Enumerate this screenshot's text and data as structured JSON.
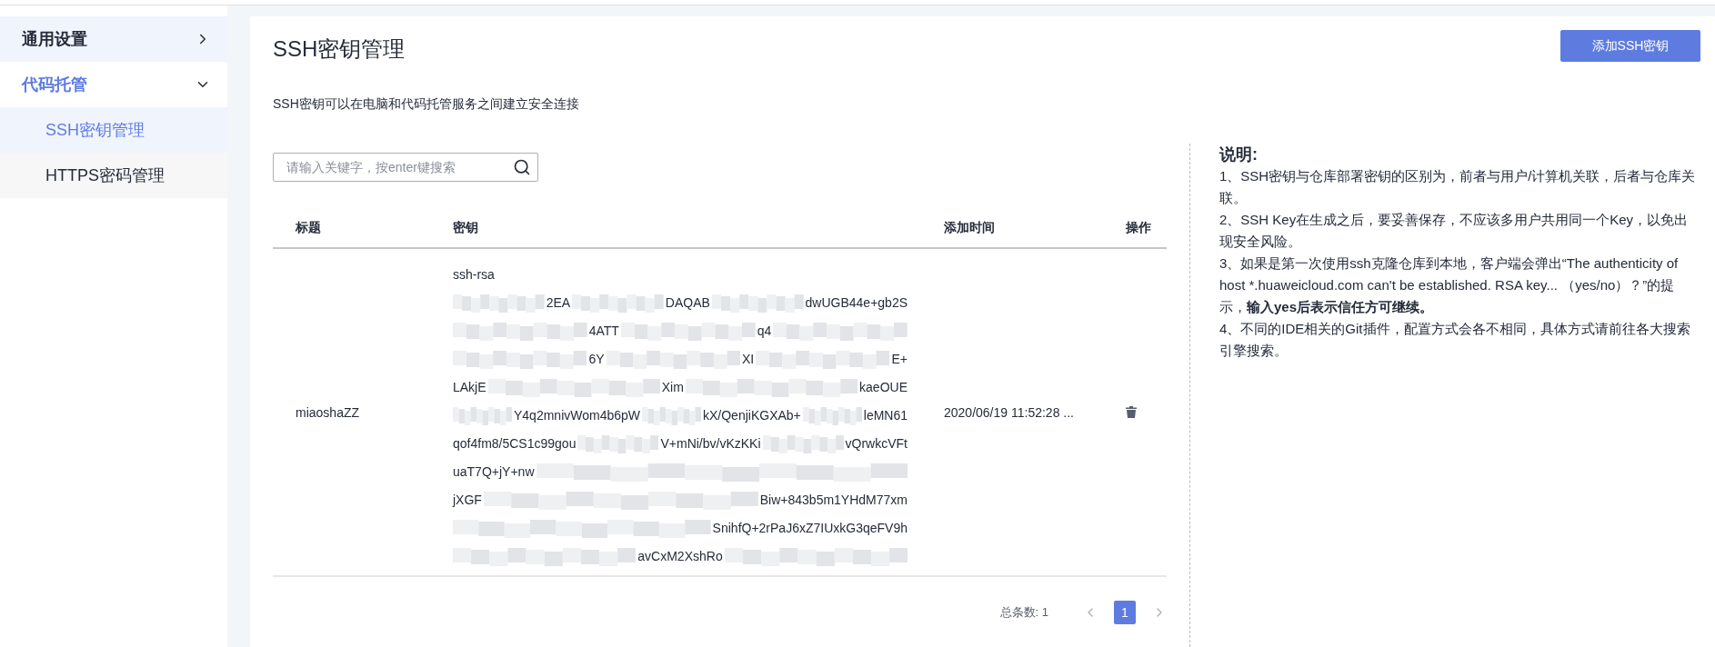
{
  "sidebar": {
    "items": [
      {
        "label": "通用设置",
        "expanded": false
      },
      {
        "label": "代码托管",
        "expanded": true,
        "children": [
          {
            "label": "SSH密钥管理",
            "selected": true
          },
          {
            "label": "HTTPS密码管理",
            "selected": false
          }
        ]
      }
    ]
  },
  "page": {
    "title": "SSH密钥管理",
    "add_button": "添加SSH密钥",
    "description": "SSH密钥可以在电脑和代码托管服务之间建立安全连接"
  },
  "search": {
    "placeholder": "请输入关键字，按enter键搜索"
  },
  "table": {
    "columns": [
      "标题",
      "密钥",
      "添加时间",
      "操作"
    ],
    "rows": [
      {
        "title": "miaoshaZZ",
        "added": "2020/06/19 11:52:28 ...",
        "key_lines": [
          [
            {
              "kind": "text",
              "text": "ssh-rsa"
            }
          ],
          [
            {
              "kind": "redacted"
            },
            {
              "kind": "text",
              "text": "2EA"
            },
            {
              "kind": "redacted"
            },
            {
              "kind": "text",
              "text": "DAQAB"
            },
            {
              "kind": "redacted"
            },
            {
              "kind": "text",
              "text": "dwUGB44e+gb2S"
            }
          ],
          [
            {
              "kind": "redacted"
            },
            {
              "kind": "text",
              "text": "4ATT"
            },
            {
              "kind": "redacted"
            },
            {
              "kind": "text",
              "text": "q4"
            },
            {
              "kind": "redacted"
            }
          ],
          [
            {
              "kind": "redacted"
            },
            {
              "kind": "text",
              "text": "6Y"
            },
            {
              "kind": "redacted"
            },
            {
              "kind": "text",
              "text": "XI"
            },
            {
              "kind": "redacted"
            },
            {
              "kind": "text",
              "text": "E+"
            }
          ],
          [
            {
              "kind": "text",
              "text": "LAkjE"
            },
            {
              "kind": "redacted"
            },
            {
              "kind": "text",
              "text": "Xim"
            },
            {
              "kind": "redacted"
            },
            {
              "kind": "text",
              "text": "kaeOUE"
            }
          ],
          [
            {
              "kind": "redacted"
            },
            {
              "kind": "text",
              "text": "Y4q2mnivWom4b6pW"
            },
            {
              "kind": "redacted"
            },
            {
              "kind": "text",
              "text": "kX/QenjiKGXAb+"
            },
            {
              "kind": "redacted"
            },
            {
              "kind": "text",
              "text": "leMN61"
            }
          ],
          [
            {
              "kind": "text",
              "text": "qof4fm8/5CS1c99gou"
            },
            {
              "kind": "redacted"
            },
            {
              "kind": "text",
              "text": "V+mNi/bv/vKzKKi"
            },
            {
              "kind": "redacted"
            },
            {
              "kind": "text",
              "text": "vQrwkcVFt"
            }
          ],
          [
            {
              "kind": "text",
              "text": "uaT7Q+jY+nw"
            },
            {
              "kind": "redacted"
            }
          ],
          [
            {
              "kind": "text",
              "text": "jXGF"
            },
            {
              "kind": "redacted"
            },
            {
              "kind": "text",
              "text": "Biw+843b5m1YHdM77xm"
            }
          ],
          [
            {
              "kind": "redacted"
            },
            {
              "kind": "text",
              "text": "SnihfQ+2rPaJ6xZ7IUxkG3qeFV9h"
            }
          ],
          [
            {
              "kind": "redacted"
            },
            {
              "kind": "text",
              "text": "avCxM2XshRo"
            },
            {
              "kind": "redacted"
            }
          ]
        ]
      }
    ]
  },
  "pagination": {
    "total": "总条数: 1",
    "pages": [
      {
        "label": "1",
        "selected": true
      }
    ]
  },
  "notes": {
    "title": "说明:",
    "items": [
      "1、SSH密钥与仓库部署密钥的区别为，前者与用户/计算机关联，后者与仓库关联。",
      "2、SSH Key在生成之后，要妥善保存，不应该多用户共用同一个Key，以免出现安全风险。",
      "3、如果是第一次使用ssh克隆仓库到本地，客户端会弹出“The authenticity of host *.huaweicloud.com can't be established. RSA key... （yes/no）？”的提示，**输入yes后表示信任方可继续。**",
      "4、不同的IDE相关的Git插件，配置方式会各不相同，具体方式请前往各大搜索引擎搜索。"
    ]
  }
}
